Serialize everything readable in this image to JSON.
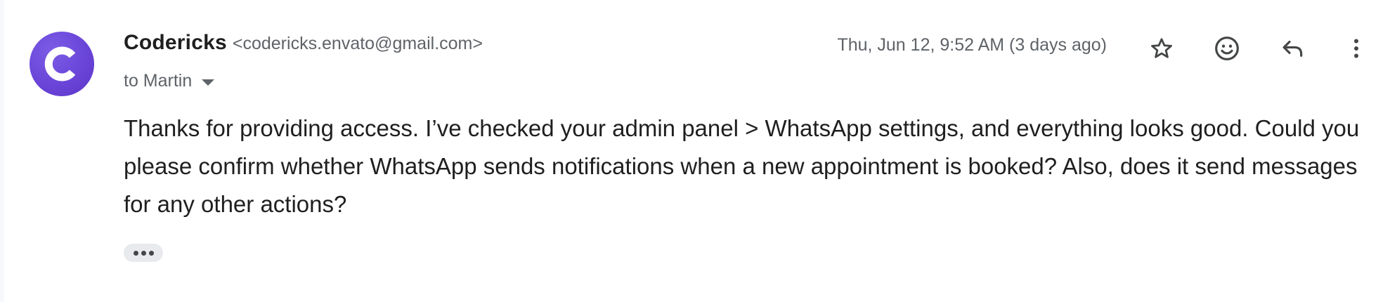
{
  "sender": {
    "name": "Codericks",
    "email": "<codericks.envato@gmail.com>",
    "avatar_initial": "C",
    "avatar_color": "#6a45d8"
  },
  "recipient": {
    "label": "to Martin"
  },
  "date": "Thu, Jun 12, 9:52 AM (3 days ago)",
  "actions": {
    "star_icon": "star-icon",
    "emoji_icon": "emoji-reaction-icon",
    "reply_icon": "reply-icon",
    "more_icon": "more-vertical-icon"
  },
  "body": {
    "text": "Thanks for providing access. I’ve checked your admin panel > WhatsApp settings, and everything looks good. Could you please confirm whether WhatsApp sends notifications when a new appointment is booked? Also, does it send messages for any other actions?"
  },
  "colors": {
    "text_primary": "#1f1f1f",
    "text_secondary": "#5f6368",
    "ellipsis_bg": "#e8eaed"
  }
}
